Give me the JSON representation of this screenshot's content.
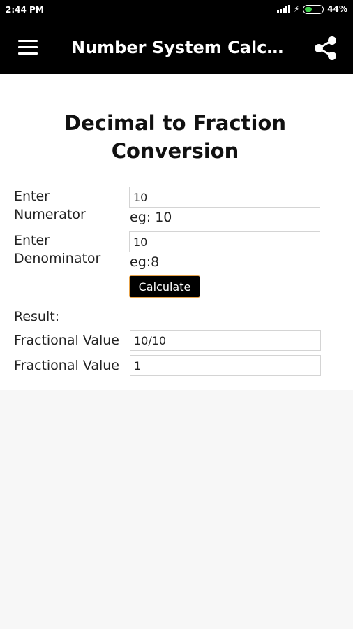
{
  "status_bar": {
    "time": "2:44 PM",
    "battery_percent": "44%",
    "battery_level": 0.44,
    "icons": [
      "signal-icon",
      "charging-icon",
      "battery-icon"
    ]
  },
  "app_bar": {
    "title": "Number System Calcul...",
    "menu_icon": "menu-icon",
    "share_icon": "share-icon"
  },
  "page": {
    "title": "Decimal to Fraction Conversion",
    "numerator": {
      "label": "Enter Numerator",
      "value": "10",
      "hint": "eg: 10"
    },
    "denominator": {
      "label": "Enter Denominator",
      "value": "10",
      "hint": "eg:8"
    },
    "calculate_label": "Calculate",
    "result_label": "Result:",
    "fraction_row": {
      "label": "Fractional Value",
      "value": "10/10"
    },
    "simplified_row": {
      "label": "Fractional Value",
      "value": "1"
    }
  },
  "colors": {
    "bar_background": "#000000",
    "button_border": "#e7a34a",
    "battery_fill": "#3ecf4a",
    "page_background": "#f7f7f7"
  }
}
